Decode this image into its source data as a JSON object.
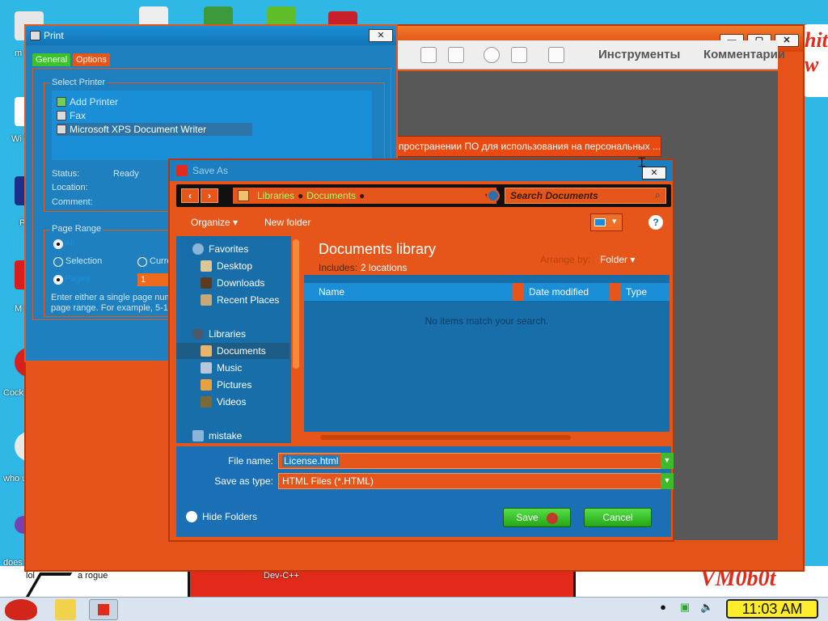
{
  "desktop": {
    "icons": [
      {
        "name": "m",
        "color": "#e6e6e6"
      },
      {
        "name": "Wi V",
        "color": "#ffffff"
      },
      {
        "name": "P",
        "color": "#1b2f8a"
      },
      {
        "name": "M R",
        "color": "#d81e1e"
      },
      {
        "name": "Cock",
        "color": "#d81e1e"
      },
      {
        "name": "who us",
        "color": "#e8e8e8"
      },
      {
        "name": "does",
        "color": "#7a3fb0"
      }
    ],
    "bottom_labels": [
      "lol",
      "a rogue",
      "Dev-C++"
    ],
    "watermark": "VM0b0t",
    "watermark_side": "hit w"
  },
  "acrobat": {
    "tools_label": "Инструменты",
    "comments_label": "Комментарии",
    "banner": "пространении ПО для использования на персональных ..."
  },
  "print_dialog": {
    "title": "Print",
    "tabs": [
      "General",
      "Options"
    ],
    "select_printer_label": "Select Printer",
    "printers": [
      {
        "label": "Add Printer",
        "selected": false
      },
      {
        "label": "Fax",
        "selected": false
      },
      {
        "label": "Microsoft XPS Document Writer",
        "selected": true
      }
    ],
    "status_label": "Status:",
    "status_value": "Ready",
    "location_label": "Location:",
    "comment_label": "Comment:",
    "page_range_label": "Page Range",
    "all_label": "All",
    "selection_label": "Selection",
    "current_label": "Curre",
    "pages_label": "Pages:",
    "pages_value": "1",
    "hint_line1": "Enter either a single page numb",
    "hint_line2": "page range.  For example, 5-12"
  },
  "save_as": {
    "title": "Save As",
    "breadcrumb": [
      "Libraries",
      "Documents"
    ],
    "search_placeholder": "Search Documents",
    "organize_label": "Organize ▾",
    "new_folder_label": "New folder",
    "nav": {
      "favorites_label": "Favorites",
      "favorites": [
        "Desktop",
        "Downloads",
        "Recent Places"
      ],
      "libraries_label": "Libraries",
      "libraries": [
        "Documents",
        "Music",
        "Pictures",
        "Videos"
      ],
      "selected": "Documents",
      "other": "mistake"
    },
    "library_title": "Documents library",
    "includes_label": "Includes:",
    "includes_value": "2 locations",
    "arrange_label": "Arrange by:",
    "arrange_value": "Folder",
    "columns": [
      "Name",
      "Date modified",
      "Type"
    ],
    "empty_message": "No items match your search.",
    "file_name_label": "File name:",
    "file_name_value": "License.html",
    "save_type_label": "Save as type:",
    "save_type_value": "HTML Files (*.HTML)",
    "hide_folders_label": "Hide Folders",
    "save_label": "Save",
    "cancel_label": "Cancel"
  },
  "taskbar": {
    "clock": "11:03 AM"
  },
  "colors": {
    "accent_orange": "#e6561a",
    "accent_blue": "#1a7ec0",
    "button_green": "#3dbb2a"
  }
}
